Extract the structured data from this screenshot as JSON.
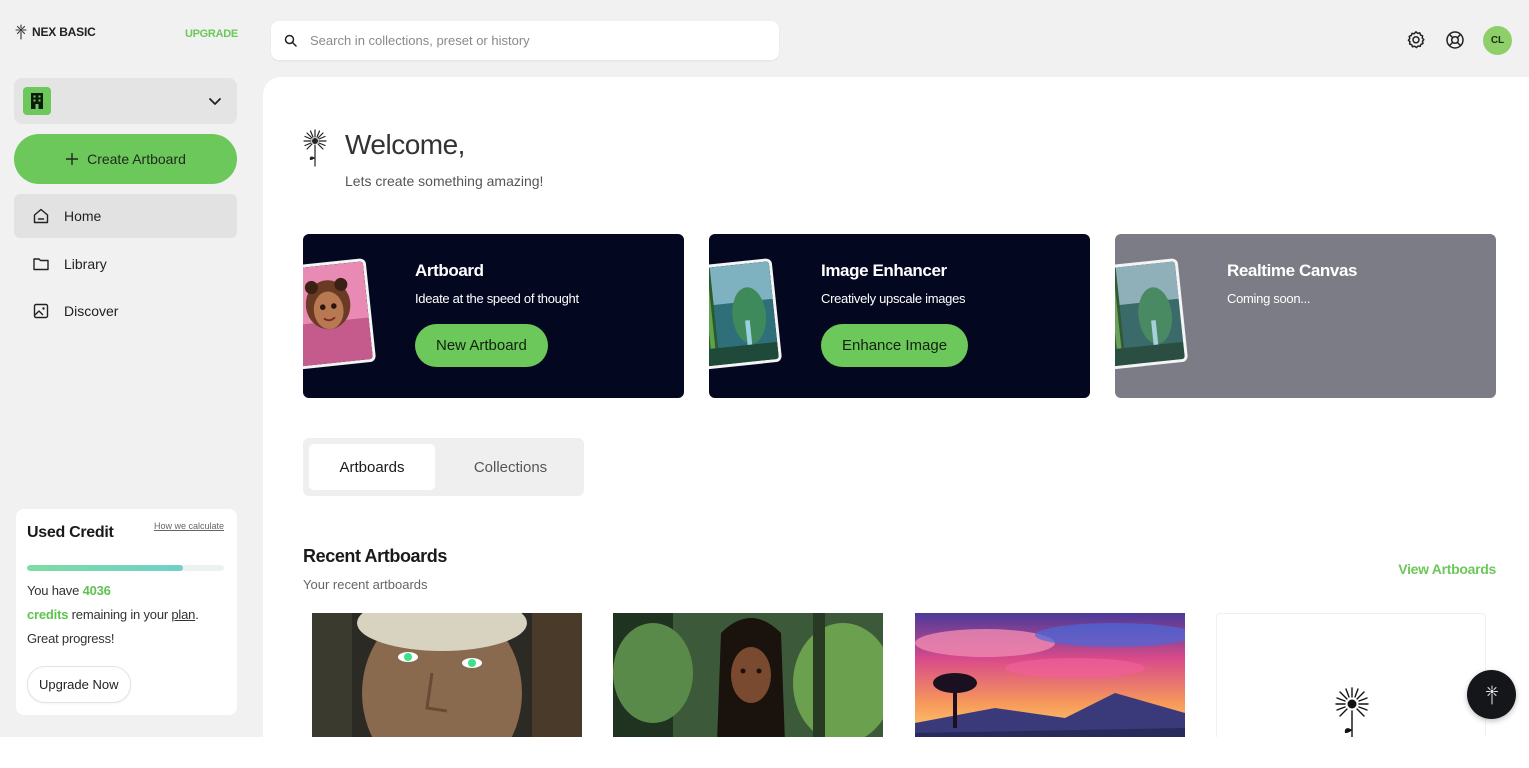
{
  "brand": {
    "name": "NEX BASIC",
    "upgrade_label": "UPGRADE",
    "accent": "#6cc85a"
  },
  "sidebar": {
    "create_label": "Create Artboard",
    "items": [
      {
        "label": "Home",
        "icon": "home-icon",
        "active": true
      },
      {
        "label": "Library",
        "icon": "folder-icon",
        "active": false
      },
      {
        "label": "Discover",
        "icon": "image-icon",
        "active": false
      }
    ]
  },
  "credit": {
    "title": "Used Credit",
    "how_label": "How we calculate",
    "progress": 0.79,
    "text_prefix": "You have",
    "amount": "4036",
    "credits_word": "credits",
    "text_mid": "remaining in your",
    "plan_word": "plan",
    "text_end": ".",
    "progress_text": "Great progress!",
    "upgrade_label": "Upgrade Now"
  },
  "search": {
    "placeholder": "Search in collections, preset or history"
  },
  "user": {
    "initials": "CL"
  },
  "welcome": {
    "title": "Welcome,",
    "subtitle": "Lets create something amazing!"
  },
  "features": [
    {
      "title": "Artboard",
      "desc": "Ideate at the speed of thought",
      "button": "New Artboard"
    },
    {
      "title": "Image Enhancer",
      "desc": "Creatively upscale images",
      "button": "Enhance Image"
    },
    {
      "title": "Realtime Canvas",
      "desc": "Coming soon..."
    }
  ],
  "tabs": [
    {
      "label": "Artboards",
      "active": true
    },
    {
      "label": "Collections",
      "active": false
    }
  ],
  "recent": {
    "title": "Recent Artboards",
    "subtitle": "Your recent artboards",
    "view_label": "View Artboards"
  }
}
